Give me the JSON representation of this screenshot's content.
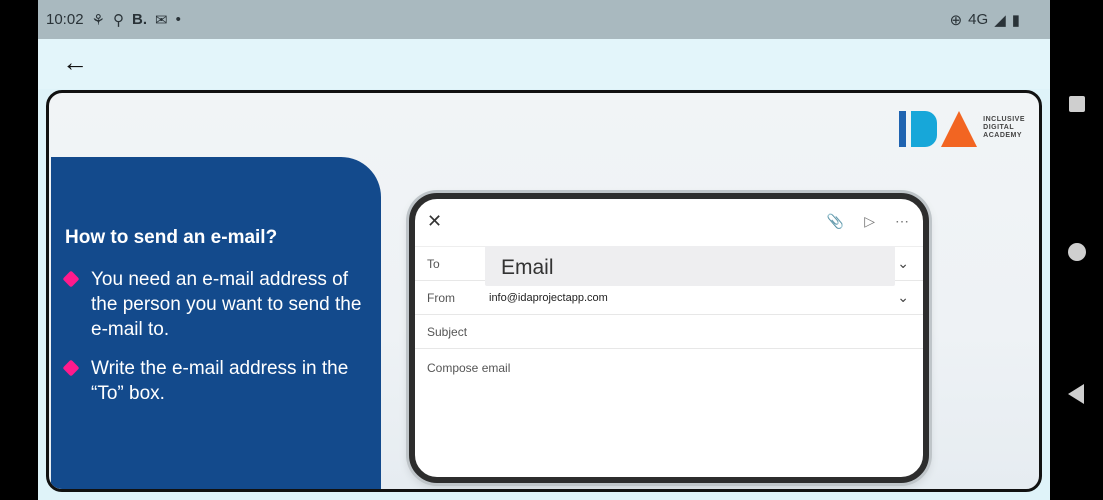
{
  "status_bar": {
    "time": "10:02",
    "left_icons": [
      "network-icon",
      "location-icon",
      "b-app-icon",
      "mail-icon",
      "dot-icon"
    ],
    "b_app_label": "B.",
    "right_network": "4G",
    "right_icons": [
      "sync-icon",
      "signal-icon",
      "battery-icon"
    ]
  },
  "app_bar": {
    "back_icon": "arrow-left-icon"
  },
  "logo": {
    "letters": "IDA",
    "line1": "INCLUSIVE",
    "line2": "DIGITAL",
    "line3": "ACADEMY"
  },
  "lesson": {
    "title": "How to send an e-mail?",
    "bullets": [
      "You need an e-mail address of the person you want to send the e-mail to.",
      "Write the e-mail address in the “To” box."
    ]
  },
  "compose": {
    "to_label": "To",
    "email_placeholder": "Email",
    "from_label": "From",
    "from_value": "info@idaprojectapp.com",
    "subject_label": "Subject",
    "body_placeholder": "Compose email"
  },
  "colors": {
    "panel": "#134a8c",
    "bullet": "#ff1a8c",
    "logo_blue": "#1f63b0",
    "logo_cyan": "#17a7d9",
    "logo_orange": "#f26522"
  }
}
